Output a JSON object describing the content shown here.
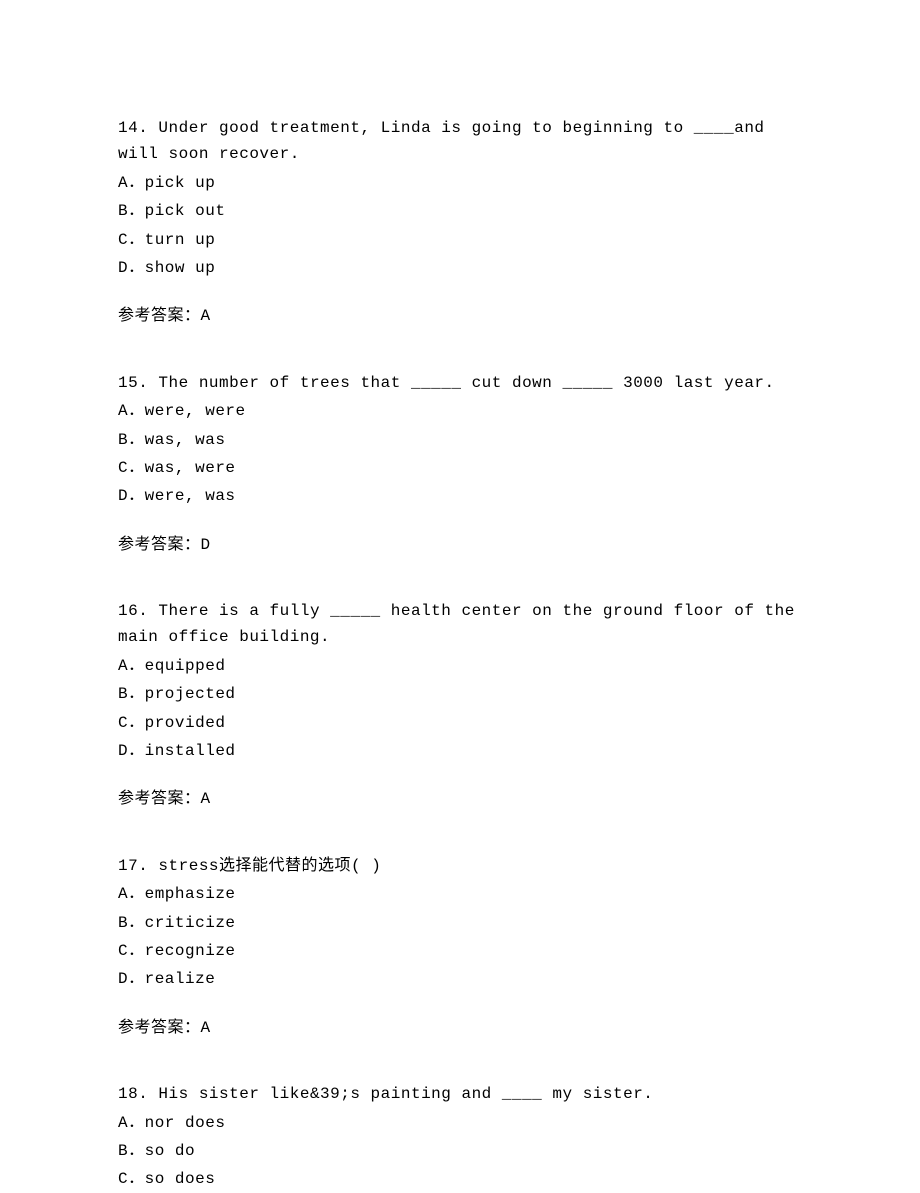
{
  "questions": [
    {
      "number": "14.",
      "text": "Under good treatment, Linda is going to beginning to ____and will soon recover.",
      "options": [
        "A．pick up",
        "B．pick out",
        "C．turn up",
        "D．show up"
      ],
      "answer_label": "参考答案：",
      "answer_value": "A"
    },
    {
      "number": "15.",
      "text": "The number of trees that _____ cut down _____ 3000 last year.",
      "options": [
        "A．were, were",
        "B．was, was",
        "C．was, were",
        "D．were, was"
      ],
      "answer_label": "参考答案：",
      "answer_value": "D"
    },
    {
      "number": "16.",
      "text": "There is a fully _____ health center on the ground floor of the main office building.",
      "options": [
        "A．equipped",
        "B．projected",
        "C．provided",
        "D．installed"
      ],
      "answer_label": "参考答案：",
      "answer_value": "A"
    },
    {
      "number": "17.",
      "text": "stress选择能代替的选项(  )",
      "options": [
        "A．emphasize",
        "B．criticize",
        "C．recognize",
        "D．realize"
      ],
      "answer_label": "参考答案：",
      "answer_value": "A"
    },
    {
      "number": "18.",
      "text": "His sister like&39;s painting and ____ my sister.",
      "options": [
        "A．nor does",
        "B．so do",
        "C．so does"
      ],
      "answer_label": "",
      "answer_value": ""
    }
  ]
}
